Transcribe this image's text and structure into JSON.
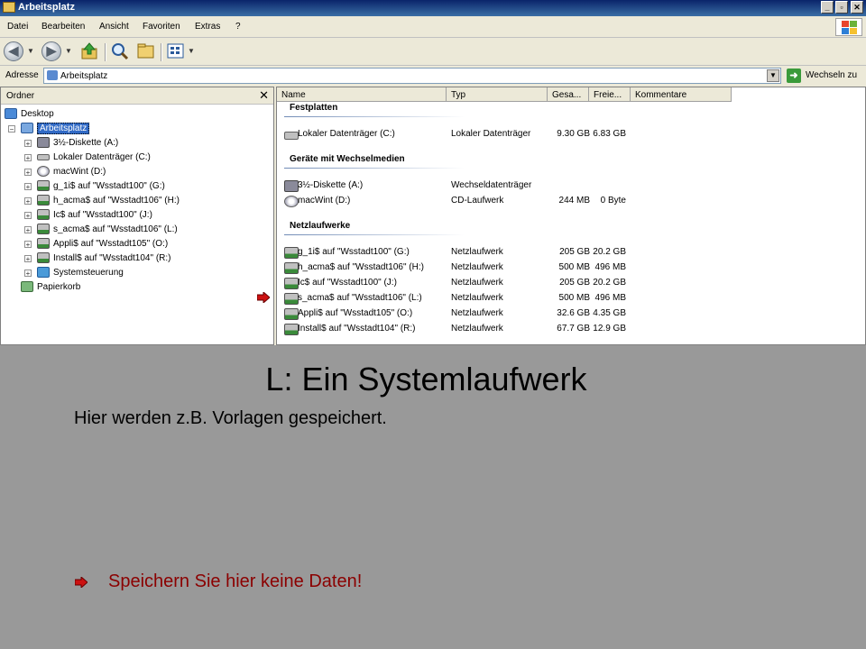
{
  "window": {
    "title": "Arbeitsplatz",
    "caption_buttons": {
      "minimize": "_",
      "maximize": "▫",
      "close": "✕"
    }
  },
  "menu": [
    "Datei",
    "Bearbeiten",
    "Ansicht",
    "Favoriten",
    "Extras",
    "?"
  ],
  "address": {
    "label": "Adresse",
    "value": "Arbeitsplatz",
    "go_label": "Wechseln zu"
  },
  "folders": {
    "title": "Ordner",
    "close": "✕",
    "tree": [
      {
        "label": "Desktop",
        "icon": "desktop-icon"
      },
      {
        "label": "Arbeitsplatz",
        "icon": "computer-icon",
        "selected": true
      },
      {
        "label": "3½-Diskette (A:)",
        "icon": "floppy-drive-icon"
      },
      {
        "label": "Lokaler Datenträger (C:)",
        "icon": "hard-drive-icon"
      },
      {
        "label": "macWint (D:)",
        "icon": "cd-drive-icon"
      },
      {
        "label": "g_1i$ auf \"Wsstadt100\" (G:)",
        "icon": "network-drive-icon"
      },
      {
        "label": "h_acma$ auf \"Wsstadt106\" (H:)",
        "icon": "network-drive-icon"
      },
      {
        "label": "Ic$ auf \"Wsstadt100\" (J:)",
        "icon": "network-drive-icon"
      },
      {
        "label": "s_acma$ auf \"Wsstadt106\" (L:)",
        "icon": "network-drive-icon"
      },
      {
        "label": "Appli$ auf \"Wsstadt105\" (O:)",
        "icon": "network-drive-icon"
      },
      {
        "label": "Install$ auf \"Wsstadt104\" (R:)",
        "icon": "network-drive-icon"
      },
      {
        "label": "Systemsteuerung",
        "icon": "control-panel-icon"
      },
      {
        "label": "Papierkorb",
        "icon": "recycle-bin-icon"
      }
    ]
  },
  "columns": [
    "Name",
    "Typ",
    "Gesa...",
    "Freie...",
    "Kommentare"
  ],
  "groups": [
    {
      "title": "Festplatten",
      "items": [
        {
          "name": "Lokaler Datenträger (C:)",
          "type": "Lokaler Datenträger",
          "size": "9.30 GB",
          "free": "6.83 GB",
          "icon": "hard-drive-icon"
        }
      ]
    },
    {
      "title": "Geräte mit Wechselmedien",
      "items": [
        {
          "name": "3½-Diskette (A:)",
          "type": "Wechseldatenträger",
          "size": "",
          "free": "",
          "icon": "floppy-drive-icon"
        },
        {
          "name": "macWint (D:)",
          "type": "CD-Laufwerk",
          "size": "244 MB",
          "free": "0 Byte",
          "icon": "cd-drive-icon"
        }
      ]
    },
    {
      "title": "Netzlaufwerke",
      "items": [
        {
          "name": "g_1i$ auf \"Wsstadt100\" (G:)",
          "type": "Netzlaufwerk",
          "size": "205 GB",
          "free": "20.2 GB",
          "icon": "network-drive-icon"
        },
        {
          "name": "h_acma$ auf \"Wsstadt106\" (H:)",
          "type": "Netzlaufwerk",
          "size": "500 MB",
          "free": "496 MB",
          "icon": "network-drive-icon"
        },
        {
          "name": "Ic$ auf \"Wsstadt100\" (J:)",
          "type": "Netzlaufwerk",
          "size": "205 GB",
          "free": "20.2 GB",
          "icon": "network-drive-icon"
        },
        {
          "name": "s_acma$ auf \"Wsstadt106\" (L:)",
          "type": "Netzlaufwerk",
          "size": "500 MB",
          "free": "496 MB",
          "icon": "network-drive-icon",
          "highlighted": true
        },
        {
          "name": "Appli$ auf \"Wsstadt105\" (O:)",
          "type": "Netzlaufwerk",
          "size": "32.6 GB",
          "free": "4.35 GB",
          "icon": "network-drive-icon"
        },
        {
          "name": "Install$ auf \"Wsstadt104\" (R:)",
          "type": "Netzlaufwerk",
          "size": "67.7 GB",
          "free": "12.9 GB",
          "icon": "network-drive-icon"
        }
      ]
    }
  ],
  "slide": {
    "title": "L: Ein Systemlaufwerk",
    "subtitle": "Hier werden z.B. Vorlagen gespeichert.",
    "warning": "Speichern Sie hier keine Daten!"
  },
  "colors": {
    "highlight_arrow": "#cc1111",
    "warning_text": "#8b0000",
    "selection": "#316ac5"
  }
}
